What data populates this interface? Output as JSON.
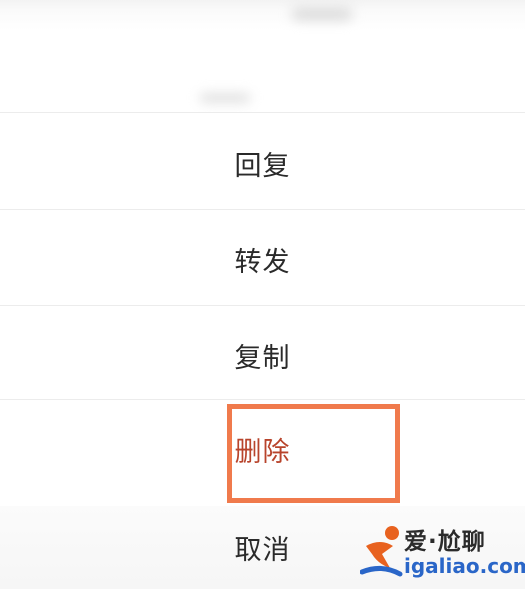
{
  "menu": {
    "items": [
      {
        "label": "回复"
      },
      {
        "label": "转发"
      },
      {
        "label": "复制"
      },
      {
        "label": "删除"
      }
    ],
    "cancel_label": "取消"
  },
  "colors": {
    "danger_text": "#b8442c",
    "highlight_border": "#f07a4c",
    "normal_text": "#2a2a2a"
  },
  "watermark": {
    "name": "爱·尬聊",
    "site": "igaliao.com",
    "logo_icon": "runner-logo-icon"
  }
}
